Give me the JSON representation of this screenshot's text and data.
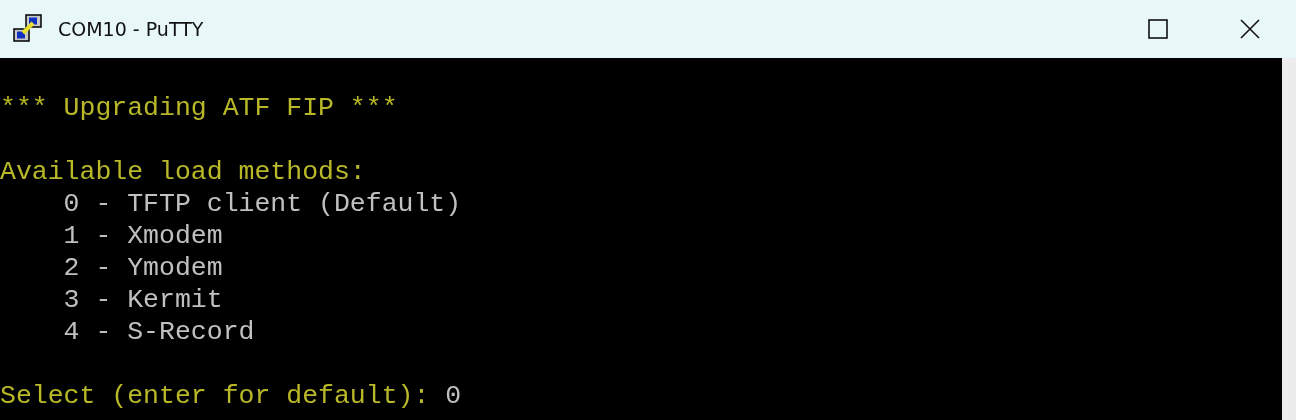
{
  "window": {
    "title": "COM10 - PuTTY"
  },
  "terminal": {
    "blocks": [
      {
        "lines": [
          {
            "text": "*** Upgrading ATF FIP ***",
            "kind": "highlight"
          }
        ]
      },
      {
        "lines": [
          {
            "text": "Available load methods:",
            "kind": "highlight"
          },
          {
            "text": "    0 - TFTP client (Default)",
            "kind": "normal"
          },
          {
            "text": "    1 - Xmodem",
            "kind": "normal"
          },
          {
            "text": "    2 - Ymodem",
            "kind": "normal"
          },
          {
            "text": "    3 - Kermit",
            "kind": "normal"
          },
          {
            "text": "    4 - S-Record",
            "kind": "normal"
          }
        ]
      },
      {
        "lines": [
          {
            "text": "Select (enter for default):",
            "kind": "highlight",
            "input": "0"
          }
        ]
      }
    ]
  }
}
